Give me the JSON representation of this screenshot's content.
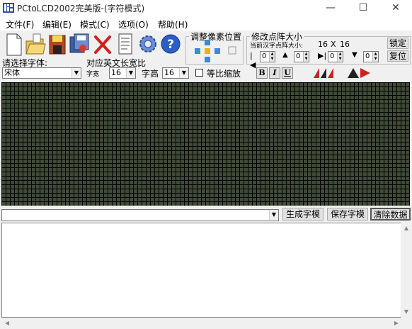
{
  "window": {
    "title": "PCtoLCD2002完美版-(字符模式)",
    "minimize_glyph": "—",
    "maximize_glyph": "☐",
    "close_glyph": "✕"
  },
  "menu": {
    "items": [
      "文件(F)",
      "编辑(E)",
      "模式(C)",
      "选项(O)",
      "帮助(H)"
    ]
  },
  "toolbar": {
    "icons": [
      "new-file-icon",
      "open-folder-icon",
      "save-icon",
      "batch-save-icon",
      "delete-icon",
      "document-icon",
      "settings-gear-icon",
      "help-icon"
    ]
  },
  "pixel_position": {
    "label": "调整像素位置"
  },
  "dot_size": {
    "label": "修改点阵大小",
    "current_label": "当前汉字点阵大小:",
    "width": "16",
    "x": "X",
    "height": "16",
    "values": [
      "0",
      "0",
      "0",
      "0"
    ],
    "confirm": "锁定",
    "reset": "复位"
  },
  "font": {
    "select_label": "请选择字体:",
    "font_value": "宋体",
    "ratio_label": "对应英文长宽比",
    "width_label": "字宽",
    "width_value": "16",
    "height_label": "字高",
    "height_value": "16",
    "scale_label": "等比缩放"
  },
  "format": {
    "bold": "B",
    "italic": "I",
    "underline": "U"
  },
  "input_row": {
    "text": "",
    "generate_button": "生成字模",
    "save_button": "保存字模",
    "clear_button": "清除数据"
  },
  "output": {
    "text": ""
  }
}
